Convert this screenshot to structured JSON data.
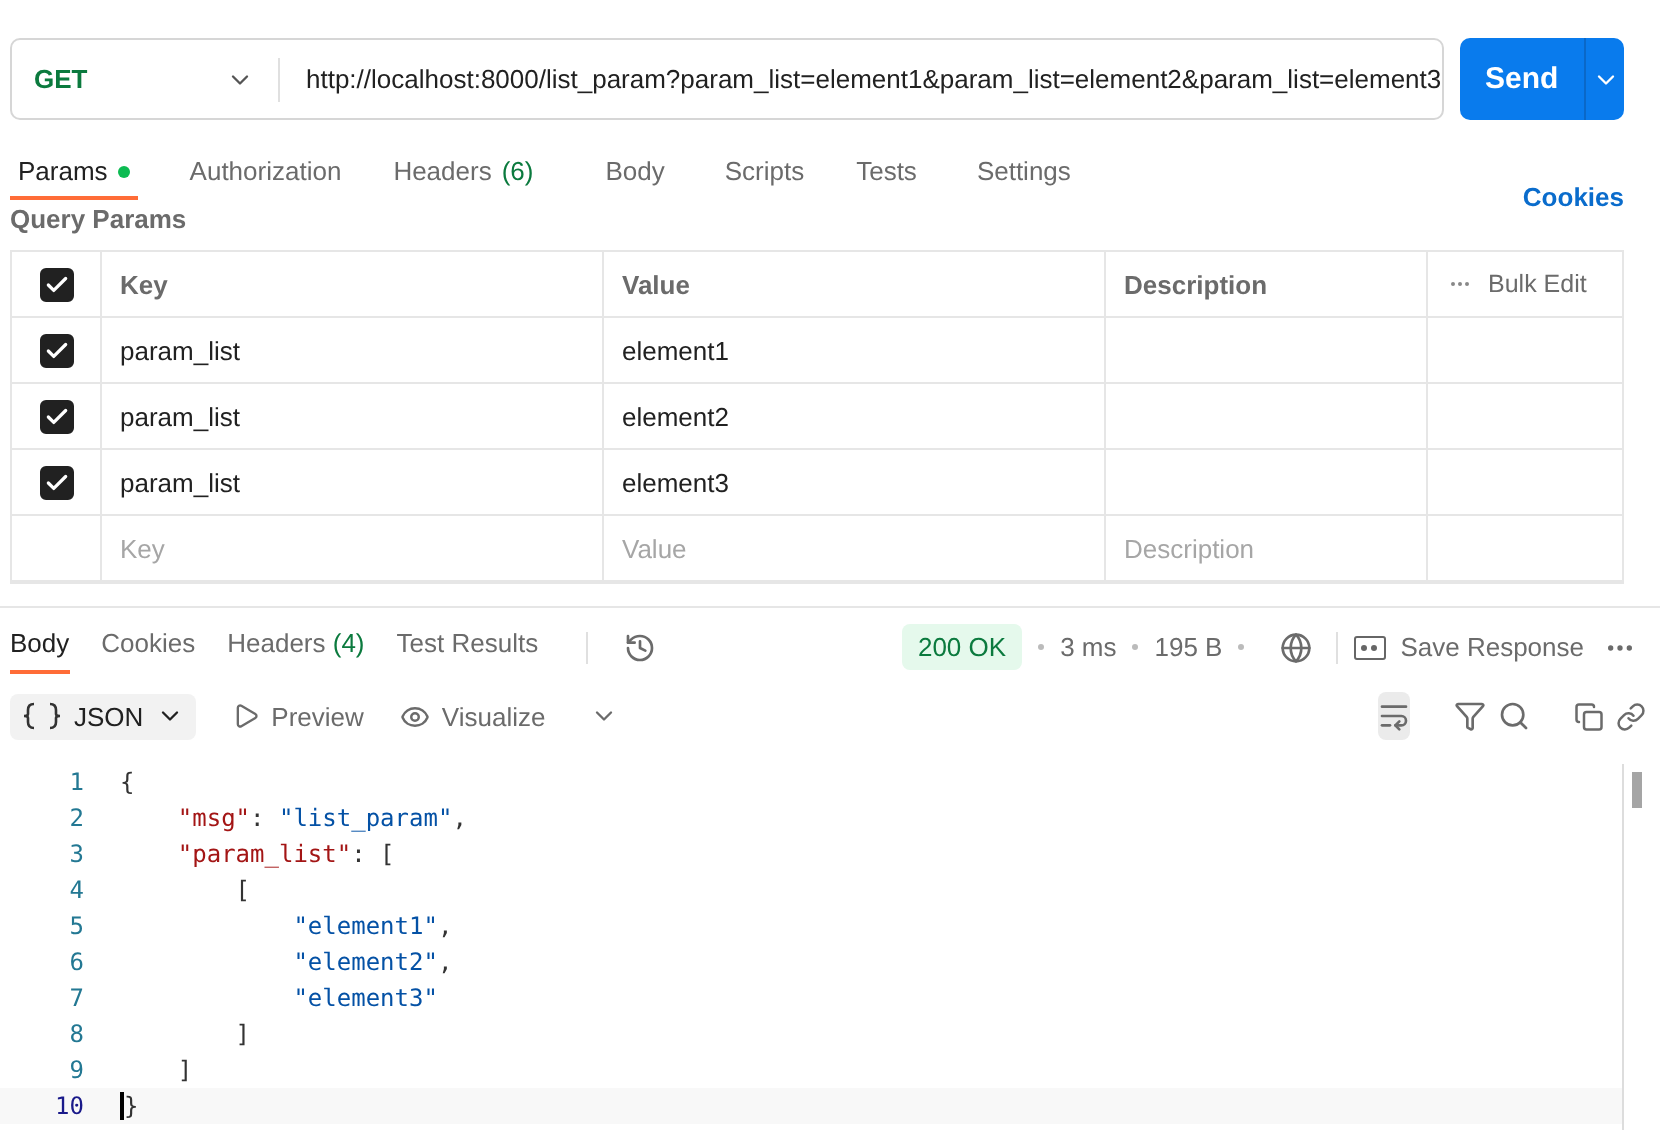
{
  "request": {
    "method": "GET",
    "url": "http://localhost:8000/list_param?param_list=element1&param_list=element2&param_list=element3",
    "send": "Send"
  },
  "request_tabs": [
    {
      "label": "Params",
      "selected": true,
      "dot": true
    },
    {
      "label": "Authorization",
      "selected": false
    },
    {
      "label": "Headers",
      "count": "(6)",
      "selected": false
    },
    {
      "label": "Body",
      "selected": false
    },
    {
      "label": "Scripts",
      "selected": false
    },
    {
      "label": "Tests",
      "selected": false
    },
    {
      "label": "Settings",
      "selected": false
    }
  ],
  "cookies_link": "Cookies",
  "section_title": "Query Params",
  "params_table": {
    "all_checked": true,
    "columns": [
      "Key",
      "Value",
      "Description"
    ],
    "bulk_edit": "Bulk Edit",
    "rows": [
      {
        "checked": true,
        "key": "param_list",
        "value": "element1"
      },
      {
        "checked": true,
        "key": "param_list",
        "value": "element2"
      },
      {
        "checked": true,
        "key": "param_list",
        "value": "element3"
      }
    ],
    "new_row": {
      "key": {
        "placeholder": "Key"
      },
      "value": {
        "placeholder": "Value"
      },
      "description": {
        "placeholder": "Description"
      }
    }
  },
  "response_tabs": [
    {
      "label": "Body",
      "selected": true
    },
    {
      "label": "Cookies",
      "selected": false
    },
    {
      "label": "Headers",
      "count": "(4)",
      "selected": false
    },
    {
      "label": "Test Results",
      "selected": false
    }
  ],
  "status": {
    "code": "200 OK",
    "time": "3 ms",
    "size": "195 B",
    "save": "Save Response"
  },
  "body_toolbar": {
    "format": "JSON",
    "preview": "Preview",
    "visualize": "Visualize",
    "wrap_on": true
  },
  "code_lines": [
    {
      "number": "1",
      "current": false,
      "tokens": [
        {
          "kind": "punct",
          "text": "{"
        }
      ]
    },
    {
      "number": "2",
      "current": false,
      "tokens": [
        {
          "kind": "key",
          "text": "    \"msg\""
        },
        {
          "kind": "punct",
          "text": ": "
        },
        {
          "kind": "string",
          "text": "\"list_param\""
        },
        {
          "kind": "punct",
          "text": ","
        }
      ]
    },
    {
      "number": "3",
      "current": false,
      "tokens": [
        {
          "kind": "key",
          "text": "    \"param_list\""
        },
        {
          "kind": "punct",
          "text": ": ["
        }
      ]
    },
    {
      "number": "4",
      "current": false,
      "tokens": [
        {
          "kind": "punct",
          "text": "        ["
        }
      ]
    },
    {
      "number": "5",
      "current": false,
      "tokens": [
        {
          "kind": "string",
          "text": "            \"element1\""
        },
        {
          "kind": "punct",
          "text": ","
        }
      ]
    },
    {
      "number": "6",
      "current": false,
      "tokens": [
        {
          "kind": "string",
          "text": "            \"element2\""
        },
        {
          "kind": "punct",
          "text": ","
        }
      ]
    },
    {
      "number": "7",
      "current": false,
      "tokens": [
        {
          "kind": "string",
          "text": "            \"element3\""
        }
      ]
    },
    {
      "number": "8",
      "current": false,
      "tokens": [
        {
          "kind": "punct",
          "text": "        ]"
        }
      ]
    },
    {
      "number": "9",
      "current": false,
      "tokens": [
        {
          "kind": "punct",
          "text": "    ]"
        }
      ]
    },
    {
      "number": "10",
      "tokens": [
        {
          "kind": "punct",
          "text": "}"
        }
      ],
      "current": true
    }
  ]
}
